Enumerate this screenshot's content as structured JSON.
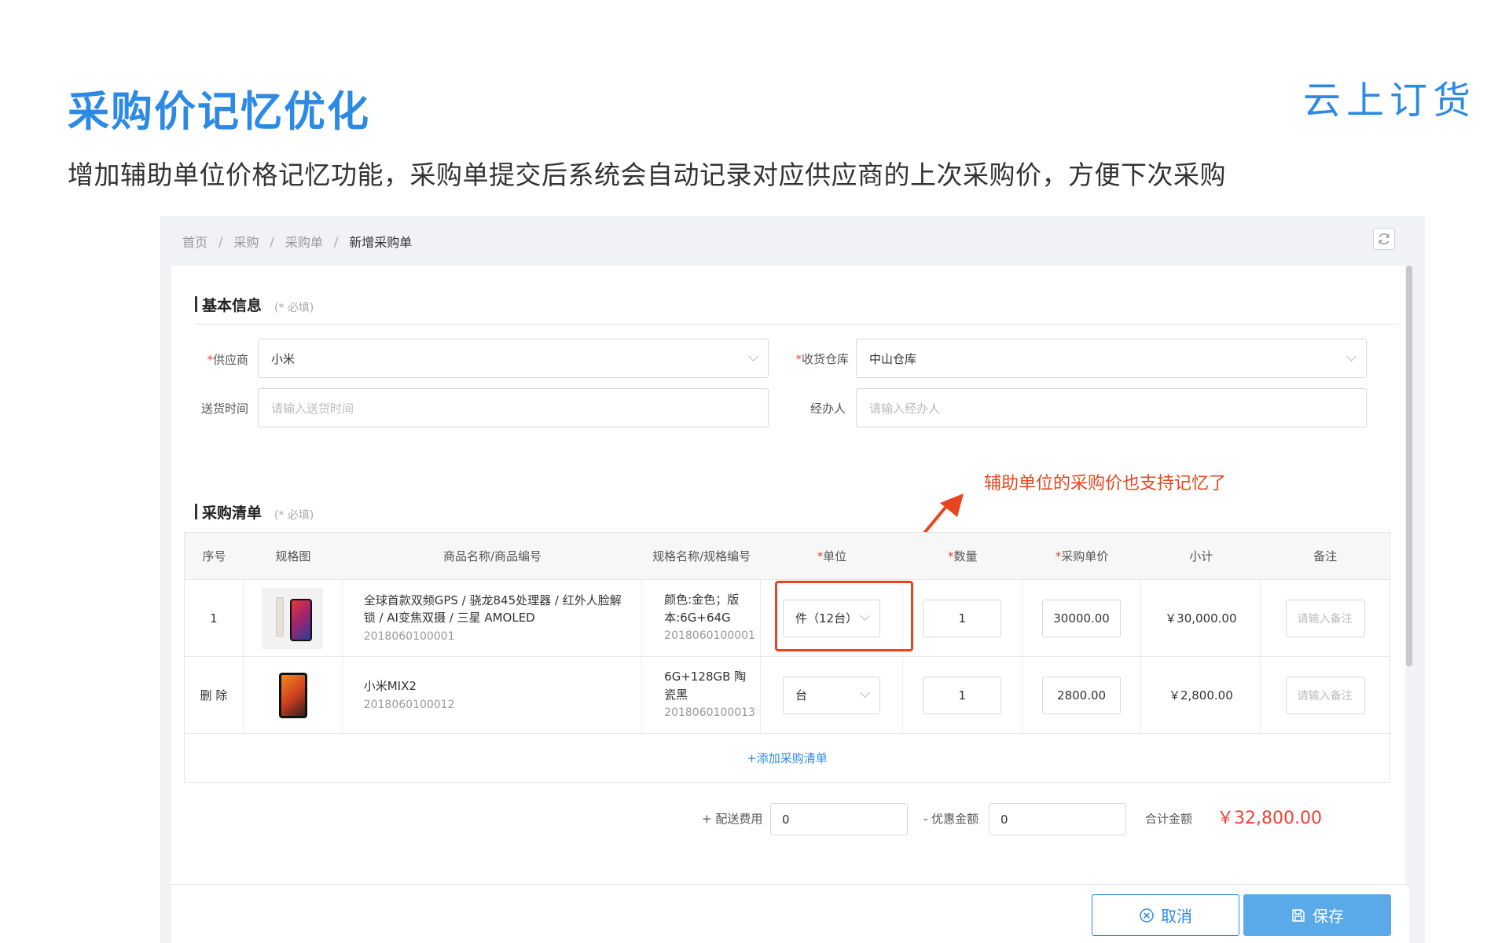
{
  "slide": {
    "title": "采购价记忆优化",
    "subtitle": "增加辅助单位价格记忆功能，采购单提交后系统会自动记录对应供应商的上次采购价，方便下次采购",
    "logo": "云上订货"
  },
  "breadcrumb": [
    "首页",
    "采购",
    "采购单",
    "新增采购单"
  ],
  "basic": {
    "title": "基本信息",
    "required_note": "(* 必填)",
    "supplier_label": "供应商",
    "supplier_value": "小米",
    "warehouse_label": "收货仓库",
    "warehouse_value": "中山仓库",
    "delivery_label": "送货时间",
    "delivery_placeholder": "请输入送货时间",
    "handler_label": "经办人",
    "handler_placeholder": "请输入经办人"
  },
  "list": {
    "title": "采购清单",
    "required_note": "(* 必填)",
    "headers": [
      "序号",
      "规格图",
      "商品名称/商品编号",
      "规格名称/规格编号",
      "单位",
      "数量",
      "采购单价",
      "小计",
      "备注"
    ],
    "rows": [
      {
        "index": "1",
        "name": "全球首款双频GPS / 骁龙845处理器 / 红外人脸解锁 / AI变焦双摄 / 三星 AMOLED",
        "code": "2018060100001",
        "spec": "颜色:金色；版本:6G+64G",
        "spec_code": "2018060100001",
        "unit": "件（12台）",
        "qty": "1",
        "price": "30000.00",
        "subtotal": "￥30,000.00",
        "note_placeholder": "请输入备注"
      },
      {
        "index": "删 除",
        "name": "小米MIX2",
        "code": "2018060100012",
        "spec": "6G+128GB 陶瓷黑",
        "spec_code": "2018060100013",
        "unit": "台",
        "qty": "1",
        "price": "2800.00",
        "subtotal": "￥2,800.00",
        "note_placeholder": "请输入备注"
      }
    ],
    "add_label": "+添加采购清单"
  },
  "annotation": "辅助单位的采购价也支持记忆了",
  "totals": {
    "shipping_label": "+ 配送费用",
    "shipping_value": "0",
    "discount_label": "- 优惠金额",
    "discount_value": "0",
    "total_label": "合计金额",
    "total_value": "￥32,800.00"
  },
  "actions": {
    "cancel": "取消",
    "save": "保存"
  },
  "colors": {
    "accent": "#2d8ae4",
    "alert": "#e8451e",
    "price": "#f04134"
  }
}
